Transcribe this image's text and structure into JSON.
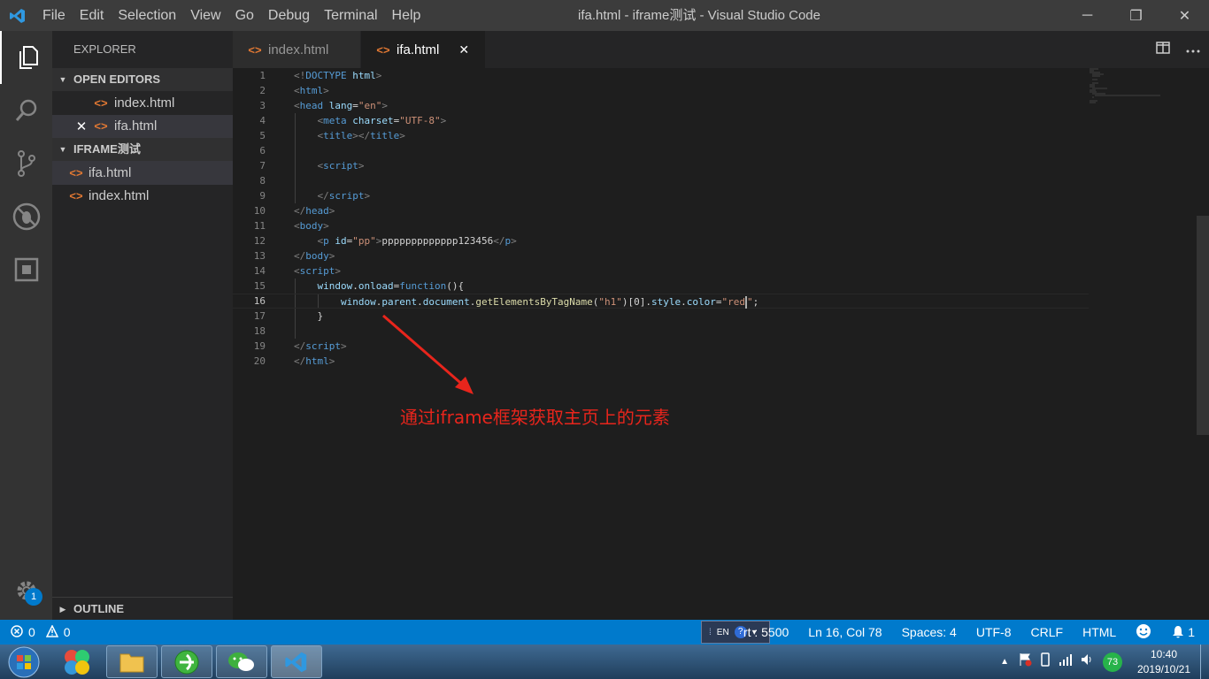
{
  "window": {
    "title": "ifa.html - iframe测试 - Visual Studio Code",
    "minimize": "─",
    "restore": "❐",
    "close": "✕"
  },
  "menu": [
    "File",
    "Edit",
    "Selection",
    "View",
    "Go",
    "Debug",
    "Terminal",
    "Help"
  ],
  "activity": {
    "settings_badge": "1"
  },
  "sidebar": {
    "title": "EXPLORER",
    "open_editors_header": "OPEN EDITORS",
    "open_editors": [
      {
        "label": "index.html"
      },
      {
        "label": "ifa.html",
        "close": "✕"
      }
    ],
    "folder_header": "IFRAME测试",
    "folder_files": [
      {
        "label": "ifa.html"
      },
      {
        "label": "index.html"
      }
    ],
    "outline_header": "OUTLINE",
    "file_icon_glyph": "<>"
  },
  "tabs": [
    {
      "label": "index.html"
    },
    {
      "label": "ifa.html",
      "close": "✕"
    }
  ],
  "editor": {
    "line_numbers": [
      "1",
      "2",
      "3",
      "4",
      "5",
      "6",
      "7",
      "8",
      "9",
      "10",
      "11",
      "12",
      "13",
      "14",
      "15",
      "16",
      "17",
      "18",
      "19",
      "20"
    ],
    "current_line": 16,
    "annotation": "通过iframe框架获取主页上的元素",
    "annotation_color": "#e8251c"
  },
  "statusbar": {
    "errors": "0",
    "warnings": "0",
    "ime_lang": "EN",
    "ime_help": "?",
    "port": "rt : 5500",
    "position": "Ln 16, Col 78",
    "spaces": "Spaces: 4",
    "encoding": "UTF-8",
    "eol": "CRLF",
    "language": "HTML",
    "notifications": "1"
  },
  "taskbar": {
    "clock_time": "10:40",
    "clock_date": "2019/10/21",
    "tray_badge": "73"
  },
  "colors": {
    "accent": "#007acc",
    "titlebar": "#3c3c3c",
    "sidebar": "#252526",
    "editor": "#1e1e1e",
    "file_icon": "#e37933"
  }
}
